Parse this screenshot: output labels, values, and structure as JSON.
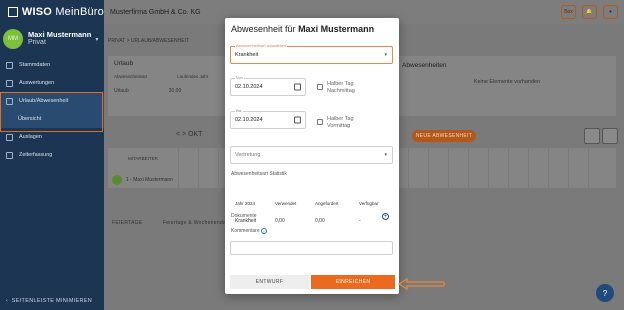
{
  "app": {
    "logo_brand": "WISO",
    "logo_product": "MeinBüro"
  },
  "user": {
    "initials": "MM",
    "name": "Maxi Mustermann",
    "role": "Privat"
  },
  "sidebar": {
    "items": [
      {
        "label": "Stammdaten"
      },
      {
        "label": "Auswertungen"
      },
      {
        "label": "Urlaub/Abwesenheit"
      },
      {
        "label": "Übersicht"
      },
      {
        "label": "Auslagen"
      },
      {
        "label": "Zeiterfassung"
      }
    ],
    "collapse_label": "SEITENLEISTE MINIMIEREN"
  },
  "topbar": {
    "company": "Musterfirma GmbH & Co. KG",
    "btn1": "Box"
  },
  "background": {
    "breadcrumb": "PRIVAT   >   URLAUB/ABWESENHEIT",
    "urlaub_title": "Urlaub",
    "urlaub_col1": "Abwesenheitsart",
    "urlaub_col2": "Laufendes Jahr",
    "urlaub_row_label": "Urlaub",
    "urlaub_row_value": "30,00",
    "right_title": "Abwesenheiten",
    "right_empty": "Keine Elemente vorhanden",
    "new_absence": "NEUE ABWESENHEIT",
    "cal_nav": "<   >   OKT",
    "ma_head": "MITARBEITER",
    "employee_initials": "M·M",
    "employee": "1 - Maxi Mustermann",
    "legend": "FEIERTAGE",
    "legend2": "Feiertage & Wochenenden"
  },
  "dialog": {
    "title_prefix": "Abwesenheit für",
    "title_name": "Maxi Mustermann",
    "absence_type": {
      "label": "Abwesenheitsart auswählen",
      "value": "Krankheit"
    },
    "from": {
      "label": "Von",
      "value": "02.10.2024"
    },
    "from_half_day": "Halber Tag Nachmittag",
    "to": {
      "label": "Bis",
      "value": "02.10.2024"
    },
    "to_half_day": "Halber Tag Vormittag",
    "substitute": {
      "placeholder": "Vertretung"
    },
    "stats_title": "Abwesenheitsart Statistik",
    "stats_headers": [
      "Jahr 2024",
      "Verwendet",
      "Angefordert",
      "Verfügbar"
    ],
    "stats_row": [
      "Krankheit",
      "0,00",
      "0,00",
      "-"
    ],
    "documents_label": "Dokumente",
    "comments_label": "Kommentare",
    "draft_button": "ENTWURF",
    "submit_button": "EINREICHEN"
  },
  "colors": {
    "accent": "#ec6a20",
    "sidebar": "#1b3553",
    "highlight": "#e86b1e"
  }
}
